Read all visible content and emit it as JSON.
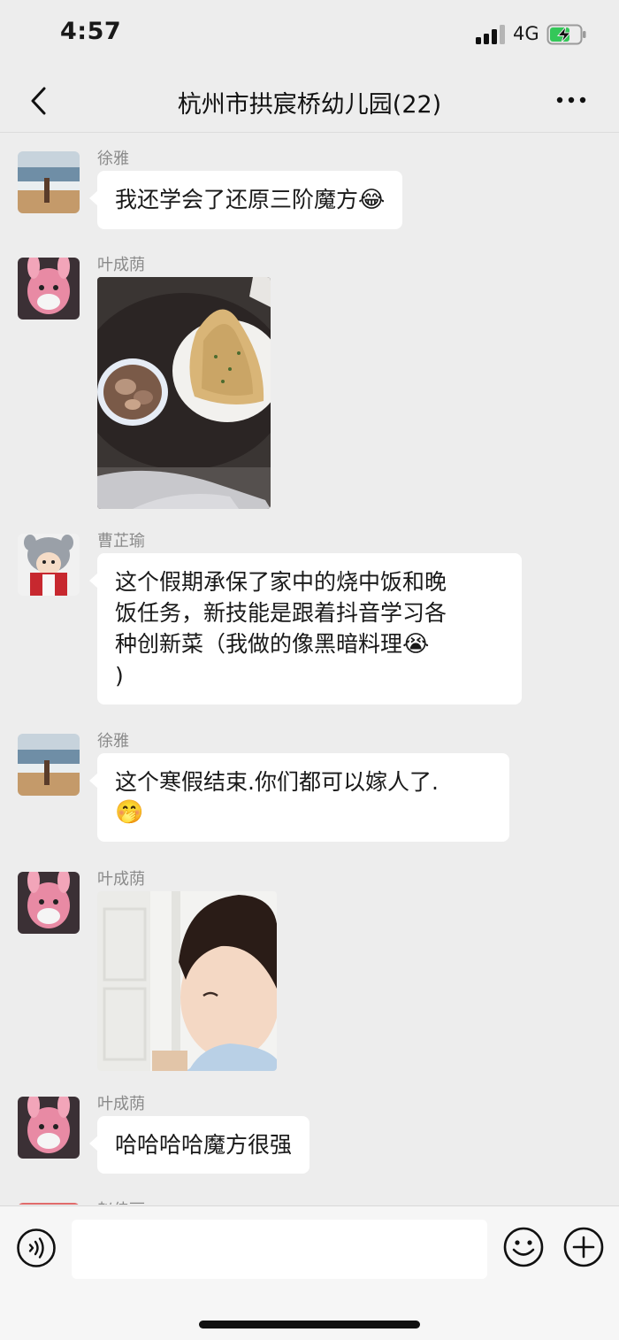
{
  "status_bar": {
    "time": "4:57",
    "network": "4G",
    "battery_charging": true
  },
  "nav": {
    "title": "杭州市拱宸桥幼儿园(22)"
  },
  "messages": [
    {
      "sender": "徐雅",
      "type": "text",
      "text": "我还学会了还原三阶魔方",
      "emoji": "😂"
    },
    {
      "sender": "叶成荫",
      "type": "image",
      "image_desc": "food-photo-flatbread-and-bowl"
    },
    {
      "sender": "曹芷瑜",
      "type": "text",
      "lines": [
        "这个假期承保了家中的烧中饭和晚",
        "饭任务，新技能是跟着抖音学习各",
        "种创新菜（我做的像黑暗料理",
        ")"
      ],
      "emoji": "😭"
    },
    {
      "sender": "徐雅",
      "type": "text",
      "lines": [
        "这个寒假结束.你们都可以嫁人了."
      ],
      "emoji": "🤭"
    },
    {
      "sender": "叶成荫",
      "type": "image",
      "image_desc": "child-photo"
    },
    {
      "sender": "叶成荫",
      "type": "text",
      "text": "哈哈哈哈魔方很强"
    },
    {
      "sender": "赵佳丽",
      "type": "partial"
    }
  ],
  "input": {
    "placeholder": ""
  },
  "colors": {
    "background": "#ededed",
    "bubble": "#ffffff",
    "sender_name": "#8a8a8a"
  },
  "icons": [
    "back-chevron-icon",
    "more-dots-icon",
    "voice-icon",
    "emoji-face-icon",
    "plus-circle-icon"
  ]
}
